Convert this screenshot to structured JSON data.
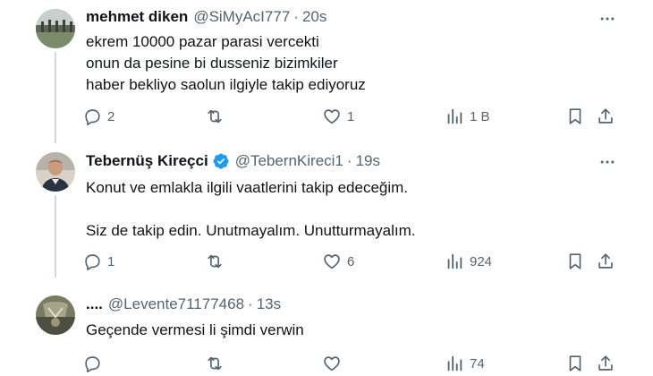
{
  "tweets": [
    {
      "name": "mehmet diken",
      "handle": "@SiMyAcI777",
      "separator": "·",
      "time": "20s",
      "text": "ekrem 10000 pazar parasi vercekti\nonun da pesine bi dusseniz bizimkiler\nhaber bekliyo saolun ilgiyle takip ediyoruz",
      "verified": false,
      "replies": "2",
      "retweets": "",
      "likes": "1",
      "views": "1 B"
    },
    {
      "name": "Tebernüş Kireçci",
      "handle": "@TebernKireci1",
      "separator": "·",
      "time": "19s",
      "text": "Konut ve emlakla ilgili vaatlerini takip edeceğim.\n\nSiz de takip edin. Unutmayalım. Unutturmayalım.",
      "verified": true,
      "replies": "1",
      "retweets": "",
      "likes": "6",
      "views": "924"
    },
    {
      "name": "....",
      "handle": "@Levente71177468",
      "separator": "·",
      "time": "13s",
      "text": "Geçende vermesi li şimdi verwin",
      "verified": false,
      "replies": "",
      "retweets": "",
      "likes": "",
      "views": "74"
    }
  ],
  "icons": {
    "reply": "reply-icon",
    "retweet": "retweet-icon",
    "like": "heart-icon",
    "views": "views-icon",
    "bookmark": "bookmark-icon",
    "share": "share-icon",
    "more": "more-icon",
    "verified": "verified-badge-icon"
  },
  "colors": {
    "text": "#0f1419",
    "secondary": "#536471",
    "verified": "#1d9bf0",
    "divider": "#eff3f4"
  }
}
